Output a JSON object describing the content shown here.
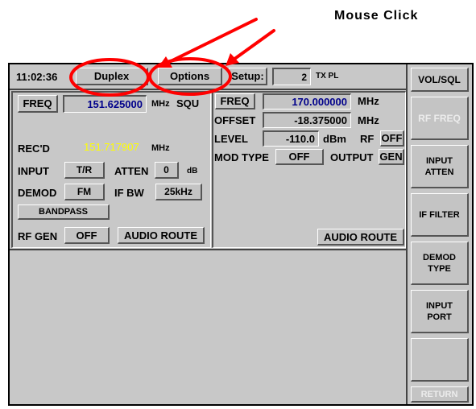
{
  "annotation": {
    "caption": "Mouse Click"
  },
  "topbar": {
    "time": "11:02:36",
    "duplex_tab": "Duplex",
    "options_tab": "Options",
    "setup_label": "Setup:",
    "setup_value": "2",
    "txpl_label": "TX PL"
  },
  "receiver": {
    "freq_button": "FREQ",
    "freq_value": "151.625000",
    "freq_unit": "MHz",
    "squelch": "SQU",
    "recd_label": "REC'D",
    "recd_value": "151.717907",
    "recd_unit": "MHz",
    "input_label": "INPUT",
    "input_value": "T/R",
    "atten_label": "ATTEN",
    "atten_value": "0",
    "atten_unit": "dB",
    "demod_label": "DEMOD",
    "demod_value": "FM",
    "ifbw_label": "IF BW",
    "ifbw_value": "25kHz",
    "bandpass": "BANDPASS",
    "rfgen_label": "RF GEN",
    "rfgen_value": "OFF",
    "audio_route": "AUDIO ROUTE"
  },
  "generator": {
    "freq_button": "FREQ",
    "freq_value": "170.000000",
    "freq_unit": "MHz",
    "offset_label": "OFFSET",
    "offset_value": "-18.375000",
    "offset_unit": "MHz",
    "level_label": "LEVEL",
    "level_value": "-110.0",
    "level_unit": "dBm",
    "rf_label": "RF",
    "rf_value": "OFF",
    "modtype_label": "MOD TYPE",
    "modtype_value": "OFF",
    "output_label": "OUTPUT",
    "output_value": "GEN",
    "audio_route": "AUDIO ROUTE"
  },
  "sidebar": {
    "vol_sql": "VOL/SQL",
    "rf_freq": "RF FREQ",
    "input_atten_1": "INPUT",
    "input_atten_2": "ATTEN",
    "if_filter": "IF FILTER",
    "demod_type_1": "DEMOD",
    "demod_type_2": "TYPE",
    "input_port_1": "INPUT",
    "input_port_2": "PORT",
    "return": "RETURN"
  },
  "colors": {
    "freq_blue": "#00008b",
    "recd_yellow": "#ffff00",
    "annotation_red": "#ff0000",
    "panel_gray": "#c8c8c8"
  }
}
